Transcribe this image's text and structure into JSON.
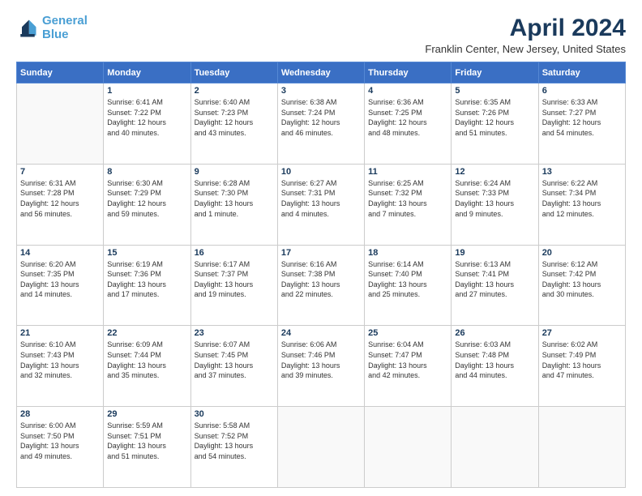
{
  "header": {
    "logo_line1": "General",
    "logo_line2": "Blue",
    "title": "April 2024",
    "subtitle": "Franklin Center, New Jersey, United States"
  },
  "columns": [
    "Sunday",
    "Monday",
    "Tuesday",
    "Wednesday",
    "Thursday",
    "Friday",
    "Saturday"
  ],
  "weeks": [
    [
      {
        "day": "",
        "info": ""
      },
      {
        "day": "1",
        "info": "Sunrise: 6:41 AM\nSunset: 7:22 PM\nDaylight: 12 hours\nand 40 minutes."
      },
      {
        "day": "2",
        "info": "Sunrise: 6:40 AM\nSunset: 7:23 PM\nDaylight: 12 hours\nand 43 minutes."
      },
      {
        "day": "3",
        "info": "Sunrise: 6:38 AM\nSunset: 7:24 PM\nDaylight: 12 hours\nand 46 minutes."
      },
      {
        "day": "4",
        "info": "Sunrise: 6:36 AM\nSunset: 7:25 PM\nDaylight: 12 hours\nand 48 minutes."
      },
      {
        "day": "5",
        "info": "Sunrise: 6:35 AM\nSunset: 7:26 PM\nDaylight: 12 hours\nand 51 minutes."
      },
      {
        "day": "6",
        "info": "Sunrise: 6:33 AM\nSunset: 7:27 PM\nDaylight: 12 hours\nand 54 minutes."
      }
    ],
    [
      {
        "day": "7",
        "info": "Sunrise: 6:31 AM\nSunset: 7:28 PM\nDaylight: 12 hours\nand 56 minutes."
      },
      {
        "day": "8",
        "info": "Sunrise: 6:30 AM\nSunset: 7:29 PM\nDaylight: 12 hours\nand 59 minutes."
      },
      {
        "day": "9",
        "info": "Sunrise: 6:28 AM\nSunset: 7:30 PM\nDaylight: 13 hours\nand 1 minute."
      },
      {
        "day": "10",
        "info": "Sunrise: 6:27 AM\nSunset: 7:31 PM\nDaylight: 13 hours\nand 4 minutes."
      },
      {
        "day": "11",
        "info": "Sunrise: 6:25 AM\nSunset: 7:32 PM\nDaylight: 13 hours\nand 7 minutes."
      },
      {
        "day": "12",
        "info": "Sunrise: 6:24 AM\nSunset: 7:33 PM\nDaylight: 13 hours\nand 9 minutes."
      },
      {
        "day": "13",
        "info": "Sunrise: 6:22 AM\nSunset: 7:34 PM\nDaylight: 13 hours\nand 12 minutes."
      }
    ],
    [
      {
        "day": "14",
        "info": "Sunrise: 6:20 AM\nSunset: 7:35 PM\nDaylight: 13 hours\nand 14 minutes."
      },
      {
        "day": "15",
        "info": "Sunrise: 6:19 AM\nSunset: 7:36 PM\nDaylight: 13 hours\nand 17 minutes."
      },
      {
        "day": "16",
        "info": "Sunrise: 6:17 AM\nSunset: 7:37 PM\nDaylight: 13 hours\nand 19 minutes."
      },
      {
        "day": "17",
        "info": "Sunrise: 6:16 AM\nSunset: 7:38 PM\nDaylight: 13 hours\nand 22 minutes."
      },
      {
        "day": "18",
        "info": "Sunrise: 6:14 AM\nSunset: 7:40 PM\nDaylight: 13 hours\nand 25 minutes."
      },
      {
        "day": "19",
        "info": "Sunrise: 6:13 AM\nSunset: 7:41 PM\nDaylight: 13 hours\nand 27 minutes."
      },
      {
        "day": "20",
        "info": "Sunrise: 6:12 AM\nSunset: 7:42 PM\nDaylight: 13 hours\nand 30 minutes."
      }
    ],
    [
      {
        "day": "21",
        "info": "Sunrise: 6:10 AM\nSunset: 7:43 PM\nDaylight: 13 hours\nand 32 minutes."
      },
      {
        "day": "22",
        "info": "Sunrise: 6:09 AM\nSunset: 7:44 PM\nDaylight: 13 hours\nand 35 minutes."
      },
      {
        "day": "23",
        "info": "Sunrise: 6:07 AM\nSunset: 7:45 PM\nDaylight: 13 hours\nand 37 minutes."
      },
      {
        "day": "24",
        "info": "Sunrise: 6:06 AM\nSunset: 7:46 PM\nDaylight: 13 hours\nand 39 minutes."
      },
      {
        "day": "25",
        "info": "Sunrise: 6:04 AM\nSunset: 7:47 PM\nDaylight: 13 hours\nand 42 minutes."
      },
      {
        "day": "26",
        "info": "Sunrise: 6:03 AM\nSunset: 7:48 PM\nDaylight: 13 hours\nand 44 minutes."
      },
      {
        "day": "27",
        "info": "Sunrise: 6:02 AM\nSunset: 7:49 PM\nDaylight: 13 hours\nand 47 minutes."
      }
    ],
    [
      {
        "day": "28",
        "info": "Sunrise: 6:00 AM\nSunset: 7:50 PM\nDaylight: 13 hours\nand 49 minutes."
      },
      {
        "day": "29",
        "info": "Sunrise: 5:59 AM\nSunset: 7:51 PM\nDaylight: 13 hours\nand 51 minutes."
      },
      {
        "day": "30",
        "info": "Sunrise: 5:58 AM\nSunset: 7:52 PM\nDaylight: 13 hours\nand 54 minutes."
      },
      {
        "day": "",
        "info": ""
      },
      {
        "day": "",
        "info": ""
      },
      {
        "day": "",
        "info": ""
      },
      {
        "day": "",
        "info": ""
      }
    ]
  ]
}
